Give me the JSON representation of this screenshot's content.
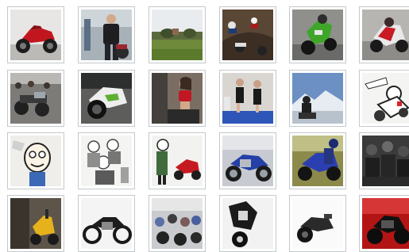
{
  "gallery": {
    "rows": [
      [
        {
          "subject": "red-sport-motorcycle"
        },
        {
          "subject": "man-with-motorcycle-at-event"
        },
        {
          "subject": "green-field-with-trees"
        },
        {
          "subject": "motocross-race"
        },
        {
          "subject": "green-sport-bike-racing"
        },
        {
          "subject": "red-white-superbike-racing"
        }
      ],
      [
        {
          "subject": "crowd-of-motorcycles"
        },
        {
          "subject": "white-green-superbike"
        },
        {
          "subject": "woman-in-red-top"
        },
        {
          "subject": "promo-girls-on-stage"
        },
        {
          "subject": "rider-mountains-snow"
        },
        {
          "subject": "cartoon-racing-rider"
        }
      ],
      [
        {
          "subject": "cartoon-face"
        },
        {
          "subject": "cartoon-crowd-sketch"
        },
        {
          "subject": "cartoon-character-and-red-bike"
        },
        {
          "subject": "blue-chopper-motorcycle"
        },
        {
          "subject": "blue-sport-bike-rider"
        },
        {
          "subject": "dark-crowd-scene"
        }
      ],
      [
        {
          "subject": "yellow-scooter-in-garage"
        },
        {
          "subject": "black-classic-motorcycle"
        },
        {
          "subject": "motorcycle-race-crowd"
        },
        {
          "subject": "black-white-motorcycle-closeup"
        },
        {
          "subject": "black-motorcycle-white-background"
        },
        {
          "subject": "red-naked-motorcycle"
        }
      ]
    ]
  }
}
